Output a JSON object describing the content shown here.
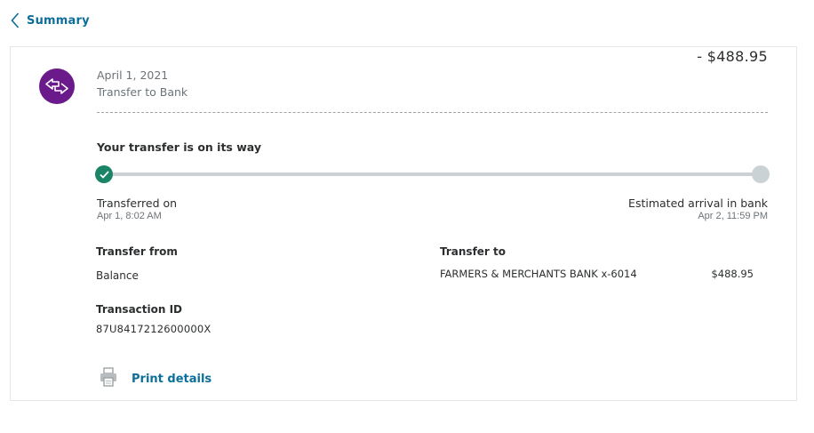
{
  "header": {
    "back_label": "Summary"
  },
  "transaction": {
    "date": "April 1, 2021",
    "type": "Transfer to Bank",
    "amount": "- $488.95",
    "icon": "transfer-arrows-icon"
  },
  "status": {
    "heading": "Your transfer is on its way",
    "progress_step": 1,
    "progress_total": 2,
    "start_label": "Transferred on",
    "start_time": "Apr 1, 8:02 AM",
    "end_label": "Estimated arrival in bank",
    "end_time": "Apr 2, 11:59 PM"
  },
  "details": {
    "from_heading": "Transfer from",
    "from_value": "Balance",
    "to_heading": "Transfer to",
    "to_bank": "FARMERS & MERCHANTS BANK x-6014",
    "to_amount": "$488.95",
    "txn_heading": "Transaction ID",
    "txn_id": "87U8417212600000X"
  },
  "actions": {
    "print_label": "Print details"
  },
  "colors": {
    "accent": "#0c6e99",
    "avatar": "#6b1a8c",
    "success": "#1a8466",
    "track": "#cbd2d6"
  }
}
